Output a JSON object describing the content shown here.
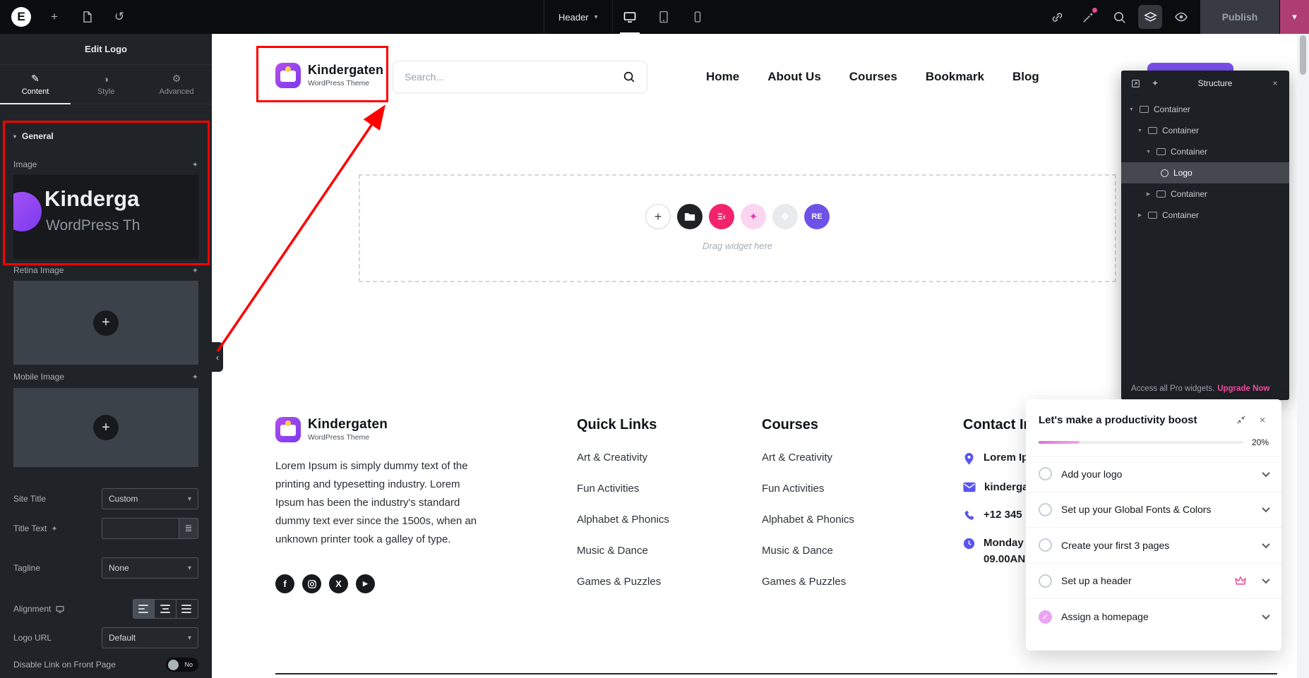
{
  "icons": {
    "e_logo": "E",
    "plus": "+",
    "history": "↺",
    "chevron_down": "▾",
    "caret_down": "▼",
    "caret_right": "▶",
    "collapse_left": "‹",
    "ai_sparkle": "✦",
    "close": "×",
    "pencil": "✎",
    "style_half": "◑",
    "gear": "⚙",
    "facebook": "f",
    "x_social": "X",
    "play": "▶",
    "grid_flower": "❖",
    "ekit": "Ξ‹",
    "re": "RE",
    "dynamic_tags": "≣",
    "check": "✓"
  },
  "topbar": {
    "template_name": "Header",
    "publish_label": "Publish"
  },
  "panel": {
    "title": "Edit Logo",
    "tabs": [
      {
        "label": "Content"
      },
      {
        "label": "Style"
      },
      {
        "label": "Advanced"
      }
    ],
    "general_section": "General",
    "controls": {
      "image_label": "Image",
      "retina_label": "Retina Image",
      "mobile_label": "Mobile Image",
      "site_title_label": "Site Title",
      "site_title_value": "Custom",
      "title_text_label": "Title Text",
      "tagline_label": "Tagline",
      "tagline_value": "None",
      "alignment_label": "Alignment",
      "logo_url_label": "Logo URL",
      "logo_url_value": "Default",
      "disable_link_label": "Disable Link on Front Page",
      "toggle_off_label": "No"
    },
    "image_preview": {
      "line1": "Kinderga",
      "line2": "WordPress Th"
    }
  },
  "canvas": {
    "header": {
      "logo_title": "Kindergaten",
      "logo_subtitle": "WordPress Theme",
      "search_placeholder": "Search...",
      "nav": [
        "Home",
        "About Us",
        "Courses",
        "Bookmark",
        "Blog"
      ]
    },
    "dropzone": {
      "hint": "Drag widget here"
    },
    "footer": {
      "logo_title": "Kindergaten",
      "logo_subtitle": "WordPress Theme",
      "about": "Lorem Ipsum is simply dummy text of the printing and typesetting industry. Lorem Ipsum has been the industry's standard dummy text ever since the 1500s, when an unknown printer took a galley of type.",
      "columns": [
        {
          "title": "Quick Links",
          "links": [
            "Art & Creativity",
            "Fun Activities",
            "Alphabet & Phonics",
            "Music & Dance",
            "Games & Puzzles"
          ]
        },
        {
          "title": "Courses",
          "links": [
            "Art & Creativity",
            "Fun Activities",
            "Alphabet & Phonics",
            "Music & Dance",
            "Games & Puzzles"
          ]
        }
      ],
      "contact": {
        "title": "Contact In",
        "address": "Lorem Ip",
        "email": "kinderga",
        "phone": "+12 345",
        "hours_line1": "Monday",
        "hours_line2": "09.00AN"
      }
    }
  },
  "structure": {
    "title": "Structure",
    "rows": [
      {
        "label": "Container"
      },
      {
        "label": "Container"
      },
      {
        "label": "Container"
      },
      {
        "label": "Logo"
      },
      {
        "label": "Container"
      },
      {
        "label": "Container"
      }
    ],
    "footer_text": "Access all Pro widgets.",
    "footer_link": "Upgrade Now"
  },
  "checklist": {
    "title": "Let's make a productivity boost",
    "progress_label": "20%",
    "items": [
      {
        "label": "Add your logo"
      },
      {
        "label": "Set up your Global Fonts & Colors"
      },
      {
        "label": "Create your first 3 pages"
      },
      {
        "label": "Set up a header"
      },
      {
        "label": "Assign a homepage"
      }
    ]
  }
}
